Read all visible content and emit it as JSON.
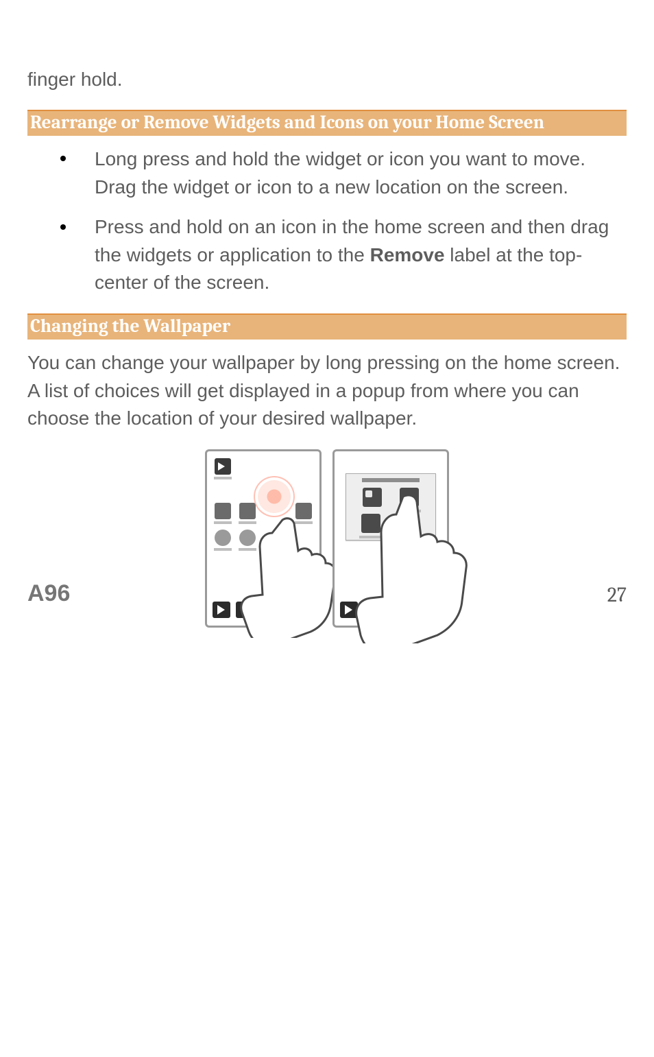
{
  "lead_text": "finger hold.",
  "sections": {
    "rearrange": {
      "heading": "Rearrange or Remove Widgets and Icons on your Home Screen",
      "bullets": [
        {
          "text": "Long press and hold the widget or icon you want to move. Drag the widget or icon to a new location on the screen."
        },
        {
          "pre": "Press and hold on an icon in the home screen and then drag the widgets or application to the ",
          "bold": "Remove",
          "post": " label at the top-center of the screen."
        }
      ]
    },
    "wallpaper": {
      "heading": "Changing the Wallpaper",
      "paragraph": "You can change your wallpaper by long pressing on the home screen. A list of choices will get displayed in a popup from where you can choose the location of your desired wallpaper."
    }
  },
  "footer": {
    "model": "A96",
    "page_number": "27"
  }
}
